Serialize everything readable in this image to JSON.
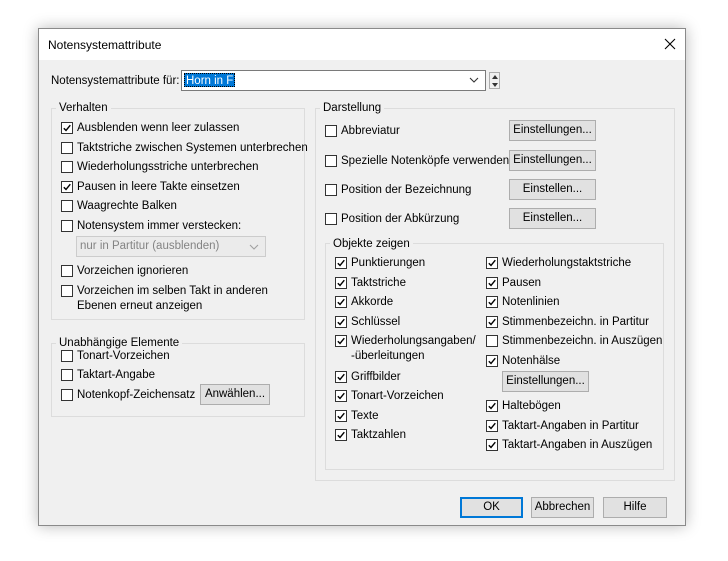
{
  "dialog": {
    "title": "Notensystemattribute",
    "close_icon": "close-icon"
  },
  "staff_select": {
    "label": "Notensystemattribute für:",
    "value": "Horn in F"
  },
  "verhalten": {
    "title": "Verhalten",
    "items": [
      {
        "label": "Ausblenden wenn leer zulassen",
        "checked": true
      },
      {
        "label": "Taktstriche zwischen Systemen unterbrechen",
        "checked": false
      },
      {
        "label": "Wiederholungsstriche unterbrechen",
        "checked": false
      },
      {
        "label": "Pausen in leere Takte einsetzen",
        "checked": true
      },
      {
        "label": "Waagrechte Balken",
        "checked": false
      },
      {
        "label": "Notensystem immer verstecken:",
        "checked": false
      }
    ],
    "hide_mode": "nur in Partitur (ausblenden)",
    "ignore_key": {
      "label": "Vorzeichen ignorieren",
      "checked": false
    },
    "redisplay": {
      "line1": "Vorzeichen im selben Takt in anderen",
      "line2": "Ebenen erneut anzeigen",
      "checked": false
    }
  },
  "unabhaengig": {
    "title": "Unabhängige Elemente",
    "items": [
      {
        "label": "Tonart-Vorzeichen",
        "checked": false
      },
      {
        "label": "Taktart-Angabe",
        "checked": false
      },
      {
        "label": "Notenkopf-Zeichensatz",
        "checked": false
      }
    ],
    "choose_button": "Anwählen..."
  },
  "darstellung": {
    "title": "Darstellung",
    "rows": [
      {
        "label": "Abbreviatur",
        "checked": false,
        "button": "Einstellungen..."
      },
      {
        "label": "Spezielle Notenköpfe verwenden",
        "checked": false,
        "button": "Einstellungen..."
      },
      {
        "label": "Position der Bezeichnung",
        "checked": false,
        "button": "Einstellen..."
      },
      {
        "label": "Position der Abkürzung",
        "checked": false,
        "button": "Einstellen..."
      }
    ]
  },
  "objekte": {
    "title": "Objekte zeigen",
    "left": [
      {
        "label": "Punktierungen",
        "checked": true
      },
      {
        "label": "Taktstriche",
        "checked": true
      },
      {
        "label": "Akkorde",
        "checked": true
      },
      {
        "label": "Schlüssel",
        "checked": true
      },
      {
        "label": "Wiederholungsangaben/",
        "label2": "-überleitungen",
        "checked": true
      },
      {
        "label": "Griffbilder",
        "checked": true
      },
      {
        "label": "Tonart-Vorzeichen",
        "checked": true
      },
      {
        "label": "Texte",
        "checked": true
      },
      {
        "label": "Taktzahlen",
        "checked": true
      }
    ],
    "right": [
      {
        "label": "Wiederholungstaktstriche",
        "checked": true
      },
      {
        "label": "Pausen",
        "checked": true
      },
      {
        "label": "Notenlinien",
        "checked": true
      },
      {
        "label": "Stimmenbezeichn. in Partitur",
        "checked": true
      },
      {
        "label": "Stimmenbezeichn. in Auszügen",
        "checked": false
      },
      {
        "label": "Notenhälse",
        "checked": true
      },
      {
        "label": "Haltebögen",
        "checked": true
      },
      {
        "label": "Taktart-Angaben in Partitur",
        "checked": true
      },
      {
        "label": "Taktart-Angaben in Auszügen",
        "checked": true
      }
    ],
    "stems_button": "Einstellungen..."
  },
  "footer": {
    "ok": "OK",
    "cancel": "Abbrechen",
    "help": "Hilfe"
  }
}
